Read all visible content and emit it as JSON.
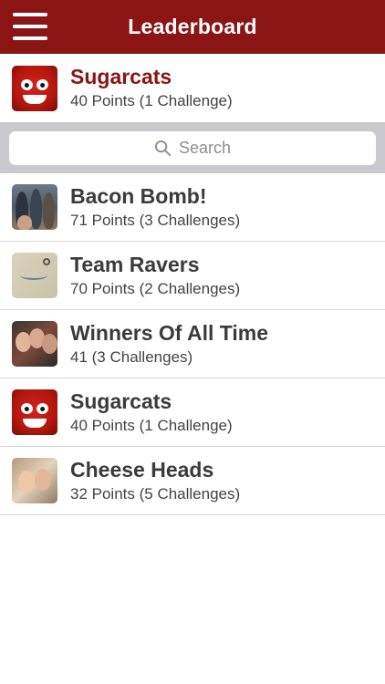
{
  "header": {
    "title": "Leaderboard",
    "menu_icon": "hamburger-menu-icon"
  },
  "my_team": {
    "name": "Sugarcats",
    "summary": "40 Points (1 Challenge)",
    "avatar": "red-candy-mascot",
    "name_color": "#8a1514"
  },
  "search": {
    "placeholder": "Search",
    "icon": "search-icon"
  },
  "leaderboard": [
    {
      "name": "Bacon Bomb!",
      "summary": "71 Points (3 Challenges)",
      "avatar": "group-photo"
    },
    {
      "name": "Team Ravers",
      "summary": "70 Points (2 Challenges)",
      "avatar": "sticky-note-photo"
    },
    {
      "name": "Winners Of All Time",
      "summary": "41 (3 Challenges)",
      "avatar": "selfie-photo"
    },
    {
      "name": "Sugarcats",
      "summary": "40 Points (1 Challenge)",
      "avatar": "red-candy-mascot"
    },
    {
      "name": "Cheese Heads",
      "summary": "32 Points (5 Challenges)",
      "avatar": "two-friends-photo"
    }
  ],
  "colors": {
    "brand": "#8a1514",
    "search_bg": "#c9c9ce",
    "divider": "#d9d9d9"
  }
}
